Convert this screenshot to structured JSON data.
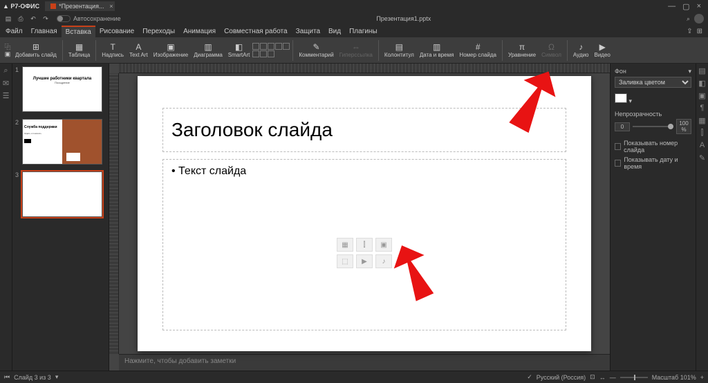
{
  "app": {
    "name": "Р7-ОФИС"
  },
  "tab": {
    "name": "*Презентация...",
    "close": "×"
  },
  "window": {
    "min": "—",
    "max": "▢",
    "close": "×"
  },
  "quick": {
    "save": "▤",
    "print": "⎙",
    "undo": "↶",
    "redo": "↷",
    "autosave": "Автосохранение",
    "doctitle": "Презентация1.pptx"
  },
  "menu": {
    "items": [
      "Файл",
      "Главная",
      "Вставка",
      "Рисование",
      "Переходы",
      "Анимация",
      "Совместная работа",
      "Защита",
      "Вид",
      "Плагины"
    ],
    "active_index": 2
  },
  "ribbon": {
    "add_slide": "Добавить слайд",
    "table": "Таблица",
    "caption": "Надпись",
    "textart": "Text Art",
    "image": "Изображение",
    "chart": "Диаграмма",
    "smartart": "SmartArt",
    "comment": "Комментарий",
    "hyperlink": "Гиперссылка",
    "header_footer": "Колонтитул",
    "date_time": "Дата и время",
    "slide_number": "Номер слайда",
    "equation": "Уравнение",
    "symbol": "Символ",
    "audio": "Аудио",
    "video": "Видео"
  },
  "thumbs": {
    "s1": {
      "title": "Лучшие работники квартала",
      "sub": "Поощрение"
    },
    "s2": {
      "title": "Служба поддержки",
      "body": "Ждать и помогать"
    },
    "s3_blank": true
  },
  "slide": {
    "title_placeholder": "Заголовок слайда",
    "body_placeholder": "• Текст слайда"
  },
  "notes": {
    "placeholder": "Нажмите, чтобы добавить заметки"
  },
  "rpanel": {
    "bg_label": "Фон",
    "fill_type": "Заливка цветом",
    "opacity_label": "Непрозрачность",
    "opacity_min": "0",
    "opacity_max": "100 %",
    "show_num": "Показывать номер слайда",
    "show_date": "Показывать дату и время"
  },
  "status": {
    "slide_counter": "Слайд 3 из 3",
    "lang": "Русский (Россия)",
    "zoom": "Масштаб 101%",
    "plus": "+",
    "minus": "—"
  }
}
